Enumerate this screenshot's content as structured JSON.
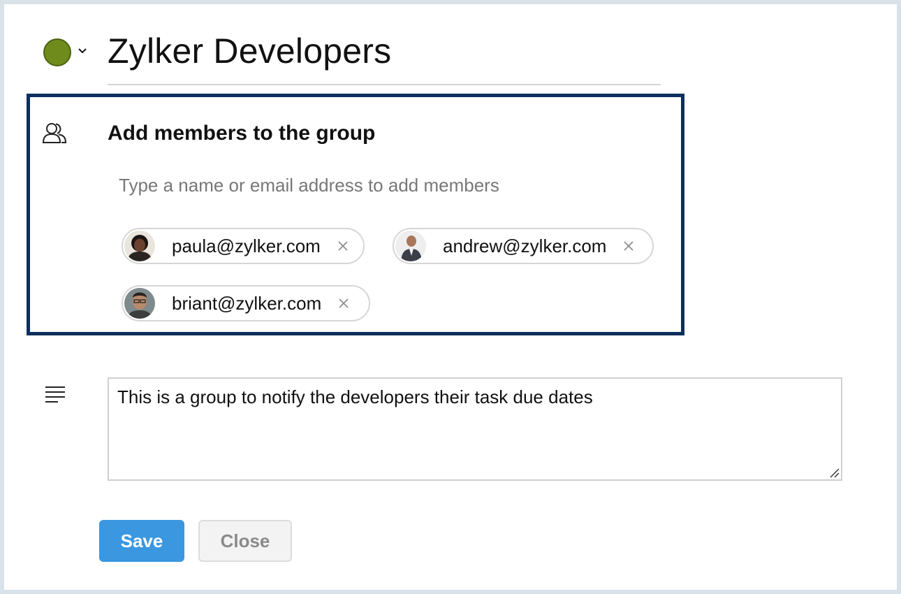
{
  "group": {
    "title": "Zylker Developers",
    "color": "#6e8b1c"
  },
  "members": {
    "heading": "Add members to the group",
    "placeholder": "Type a name or email address to add members",
    "chips": [
      {
        "email": "paula@zylker.com"
      },
      {
        "email": "andrew@zylker.com"
      },
      {
        "email": "briant@zylker.com"
      }
    ]
  },
  "description": {
    "text": "This is a group to notify the developers their task due dates"
  },
  "actions": {
    "save_label": "Save",
    "close_label": "Close"
  },
  "colors": {
    "accent": "#3a97e0",
    "box_border": "#0d2f5c"
  }
}
